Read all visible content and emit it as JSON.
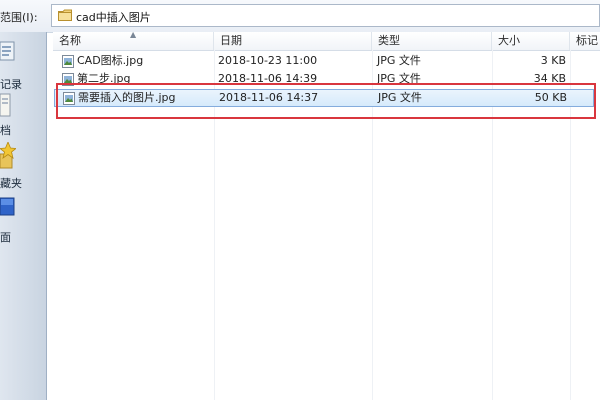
{
  "topbar": {
    "look_in_label": "范围(I):",
    "path_text": "cad中插入图片"
  },
  "places": [
    {
      "label": "记录",
      "icon": "recent-icon"
    },
    {
      "label": "档",
      "icon": "documents-icon"
    },
    {
      "label": "藏夹",
      "icon": "favorites-icon"
    },
    {
      "label": "面",
      "icon": "desktop-icon"
    }
  ],
  "columns": [
    {
      "key": "name",
      "label": "名称"
    },
    {
      "key": "date",
      "label": "日期"
    },
    {
      "key": "type",
      "label": "类型"
    },
    {
      "key": "size",
      "label": "大小"
    },
    {
      "key": "tags",
      "label": "标记"
    }
  ],
  "files": [
    {
      "name": "CAD图标.jpg",
      "date": "2018-10-23 11:00",
      "type": "JPG 文件",
      "size": "3 KB",
      "icon": "image-file-icon",
      "selected": false
    },
    {
      "name": "第二步.jpg",
      "date": "2018-11-06 14:39",
      "type": "JPG 文件",
      "size": "34 KB",
      "icon": "image-file-icon",
      "selected": false
    },
    {
      "name": "需要插入的图片.jpg",
      "date": "2018-11-06 14:37",
      "type": "JPG 文件",
      "size": "50 KB",
      "icon": "image-file-icon",
      "selected": true
    }
  ],
  "colors": {
    "selection_fill": "#d6eafb",
    "selection_border": "#84acdd",
    "highlight_border": "#d9363e",
    "places_background": "#c9d4e1"
  }
}
